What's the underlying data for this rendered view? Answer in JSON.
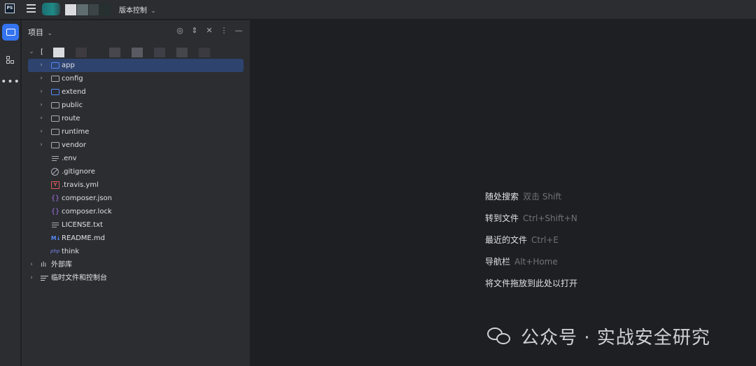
{
  "titlebar": {
    "app_logo": "PS",
    "vcs_label": "版本控制",
    "vcs_dropdown_icon": "chevron-down-icon"
  },
  "toolstrip": {
    "items": [
      {
        "name": "project",
        "icon": "folder-icon",
        "active": true
      },
      {
        "name": "structure",
        "icon": "structure-icon",
        "active": false
      },
      {
        "name": "more",
        "icon": "more-icon",
        "active": false
      }
    ]
  },
  "project_panel": {
    "title": "项目",
    "root_label": "[",
    "tree": [
      {
        "label": "app",
        "type": "folder",
        "expandable": true,
        "selected": true,
        "color": "#548af7"
      },
      {
        "label": "config",
        "type": "folder",
        "expandable": true
      },
      {
        "label": "extend",
        "type": "folder",
        "expandable": true,
        "color": "#548af7"
      },
      {
        "label": "public",
        "type": "folder",
        "expandable": true
      },
      {
        "label": "route",
        "type": "folder",
        "expandable": true
      },
      {
        "label": "runtime",
        "type": "folder",
        "expandable": true
      },
      {
        "label": "vendor",
        "type": "folder",
        "expandable": true
      },
      {
        "label": ".env",
        "type": "text-file"
      },
      {
        "label": ".gitignore",
        "type": "ignore-file"
      },
      {
        "label": ".travis.yml",
        "type": "yaml-file"
      },
      {
        "label": "composer.json",
        "type": "json-file"
      },
      {
        "label": "composer.lock",
        "type": "json-file"
      },
      {
        "label": "LICENSE.txt",
        "type": "text-file"
      },
      {
        "label": "README.md",
        "type": "markdown-file"
      },
      {
        "label": "think",
        "type": "php-file"
      }
    ],
    "external_libraries": "外部库",
    "scratches": "临时文件和控制台"
  },
  "editor_hints": [
    {
      "label": "随处搜索",
      "key": "双击 Shift"
    },
    {
      "label": "转到文件",
      "key": "Ctrl+Shift+N"
    },
    {
      "label": "最近的文件",
      "key": "Ctrl+E"
    },
    {
      "label": "导航栏",
      "key": "Alt+Home"
    },
    {
      "label": "将文件拖放到此处以打开",
      "key": ""
    }
  ],
  "watermark": {
    "text": "公众号 · 实战安全研究"
  }
}
